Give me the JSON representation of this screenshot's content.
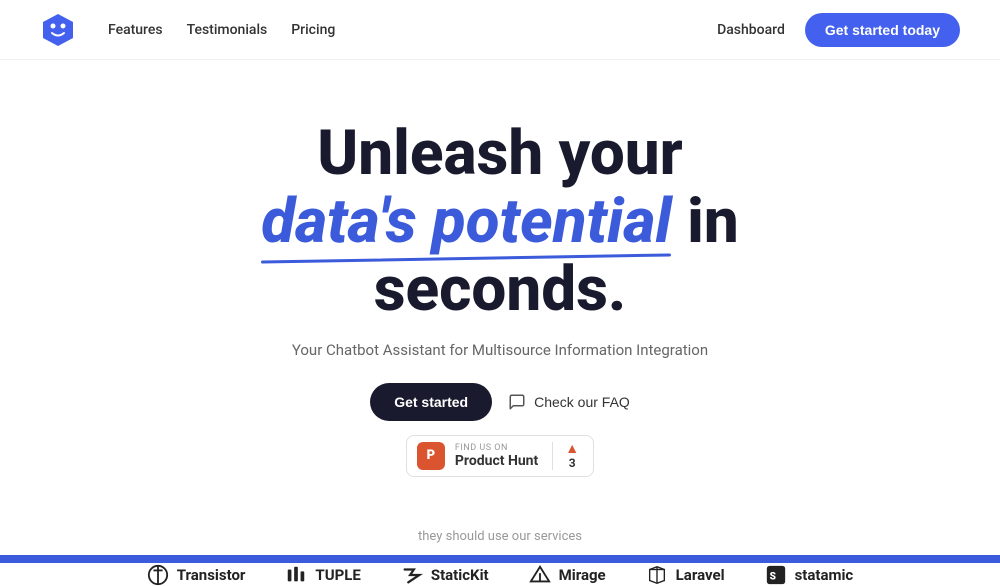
{
  "nav": {
    "links": [
      {
        "label": "Features",
        "id": "features"
      },
      {
        "label": "Testimonials",
        "id": "testimonials"
      },
      {
        "label": "Pricing",
        "id": "pricing"
      }
    ],
    "dashboard_label": "Dashboard",
    "cta_label": "Get started today"
  },
  "hero": {
    "title_line1": "Unleash your",
    "title_highlight": "data's potential",
    "title_line2": " in",
    "title_line3": "seconds.",
    "subtitle": "Your Chatbot Assistant for Multisource Information Integration",
    "cta_label": "Get started",
    "faq_label": "Check our FAQ"
  },
  "product_hunt": {
    "find_on": "FIND US ON",
    "name": "Product Hunt",
    "votes": "3"
  },
  "logos": {
    "label": "they should use our services",
    "items": [
      {
        "name": "Transistor",
        "icon": "transistor"
      },
      {
        "name": "TUPLE",
        "icon": "tuple"
      },
      {
        "name": "StaticKit",
        "icon": "statickit"
      },
      {
        "name": "Mirage",
        "icon": "mirage"
      },
      {
        "name": "Laravel",
        "icon": "laravel"
      },
      {
        "name": "statamic",
        "icon": "statamic"
      }
    ]
  }
}
